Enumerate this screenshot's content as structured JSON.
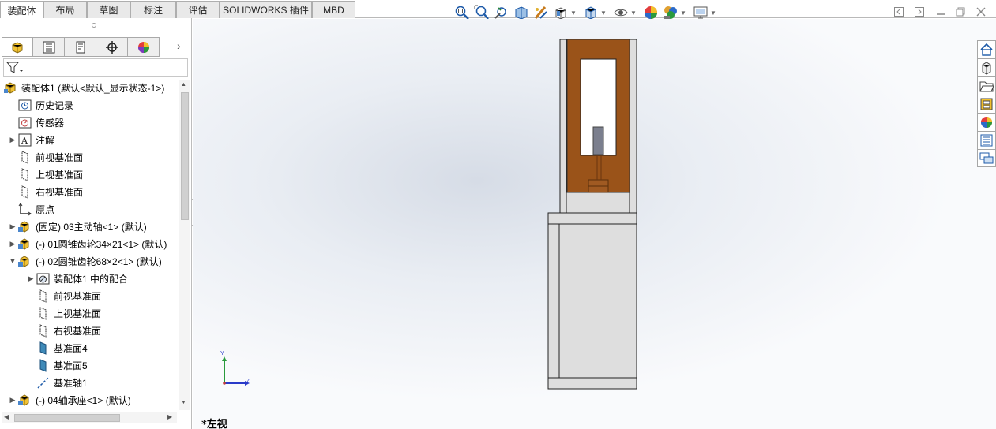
{
  "command_tabs": [
    "装配体",
    "布局",
    "草图",
    "标注",
    "评估",
    "SOLIDWORKS 插件",
    "MBD"
  ],
  "view_toolbar": {
    "buttons": [
      "zoom-to-fit-icon",
      "zoom-to-area-icon",
      "previous-view-icon",
      "section-view-icon",
      "dynamic-annotation-icon",
      "view-orientation-icon",
      "display-style-icon",
      "hide-show-items-icon",
      "edit-appearance-icon",
      "apply-scene-icon",
      "view-settings-icon"
    ]
  },
  "panel_tabs": [
    "featuremanager-icon",
    "propertymanager-icon",
    "configurationmanager-icon",
    "dimxpertmanager-icon",
    "displaymanager-icon"
  ],
  "tree": {
    "root": "装配体1 (默认<默认_显示状态-1>)",
    "items": [
      {
        "label": "历史记录",
        "icon": "history-icon"
      },
      {
        "label": "传感器",
        "icon": "sensor-icon"
      },
      {
        "label": "注解",
        "icon": "annotation-icon"
      },
      {
        "label": "前视基准面",
        "icon": "plane-icon"
      },
      {
        "label": "上视基准面",
        "icon": "plane-icon"
      },
      {
        "label": "右视基准面",
        "icon": "plane-icon"
      },
      {
        "label": "原点",
        "icon": "origin-icon"
      },
      {
        "label": "(固定) 03主动轴<1> (默认)",
        "icon": "part-icon"
      },
      {
        "label": "(-) 01圆锥齿轮34×21<1> (默认)",
        "icon": "part-icon"
      },
      {
        "label": "(-) 02圆锥齿轮68×2<1> (默认)",
        "icon": "part-icon"
      },
      {
        "label": "装配体1 中的配合",
        "icon": "mates-icon"
      },
      {
        "label": "前视基准面",
        "icon": "plane-icon"
      },
      {
        "label": "上视基准面",
        "icon": "plane-icon"
      },
      {
        "label": "右视基准面",
        "icon": "plane-icon"
      },
      {
        "label": "基准面4",
        "icon": "plane-icon"
      },
      {
        "label": "基准面5",
        "icon": "plane-icon"
      },
      {
        "label": "基准轴1",
        "icon": "axis-icon"
      },
      {
        "label": "(-) 04轴承座<1> (默认)",
        "icon": "part-icon"
      }
    ]
  },
  "triad": {
    "y": "Y",
    "z": "Z"
  },
  "view_label": "*左视",
  "colors": {
    "wood": "#9a5319",
    "part_gray": "#dedede",
    "shaft": "#7b7f8e",
    "accent_blue": "#1e5ba8"
  }
}
